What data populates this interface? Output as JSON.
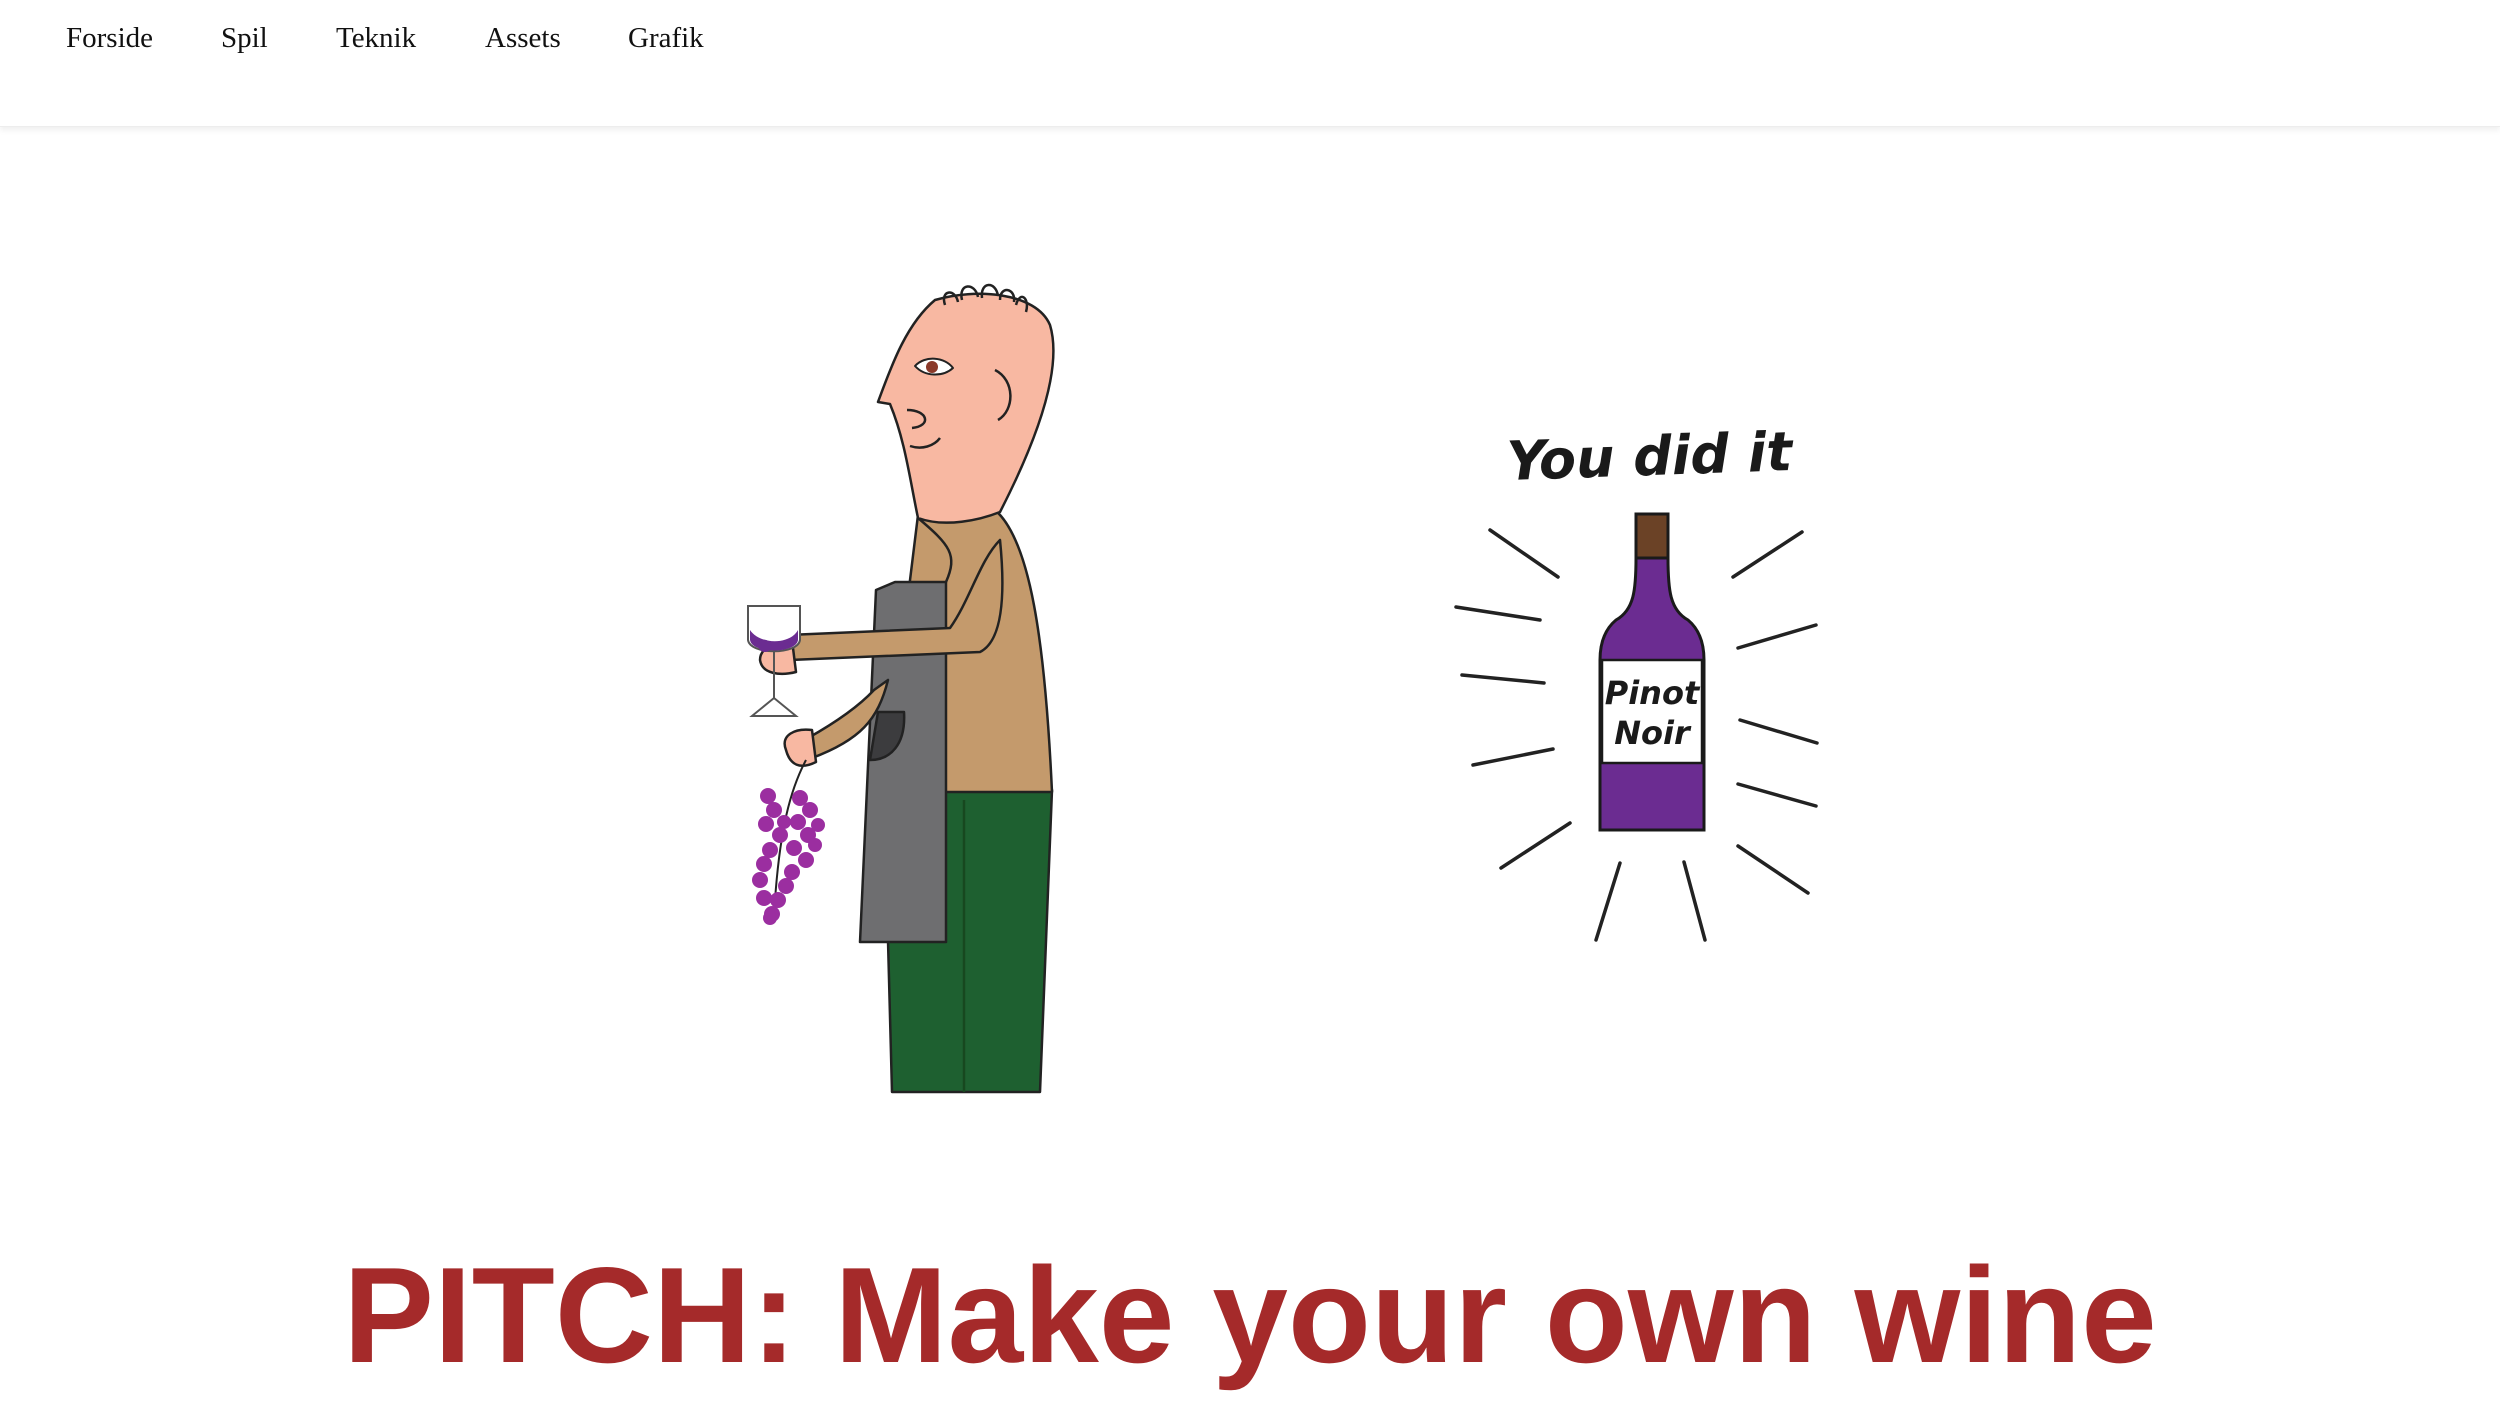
{
  "nav": {
    "items": [
      {
        "label": "Forside"
      },
      {
        "label": "Spil"
      },
      {
        "label": "Teknik"
      },
      {
        "label": "Assets"
      },
      {
        "label": "Grafik"
      }
    ]
  },
  "illustration": {
    "caption": "You did it",
    "bottle_label_line1": "Pinot",
    "bottle_label_line2": "Noir"
  },
  "page": {
    "title": "PITCH: Make your own wine"
  },
  "colors": {
    "title": "#a52a2a",
    "wine": "#6b2c91",
    "skin": "#f8b8a2",
    "sweater": "#c49a6c",
    "apron": "#6e6e70",
    "pants": "#1e6030"
  }
}
